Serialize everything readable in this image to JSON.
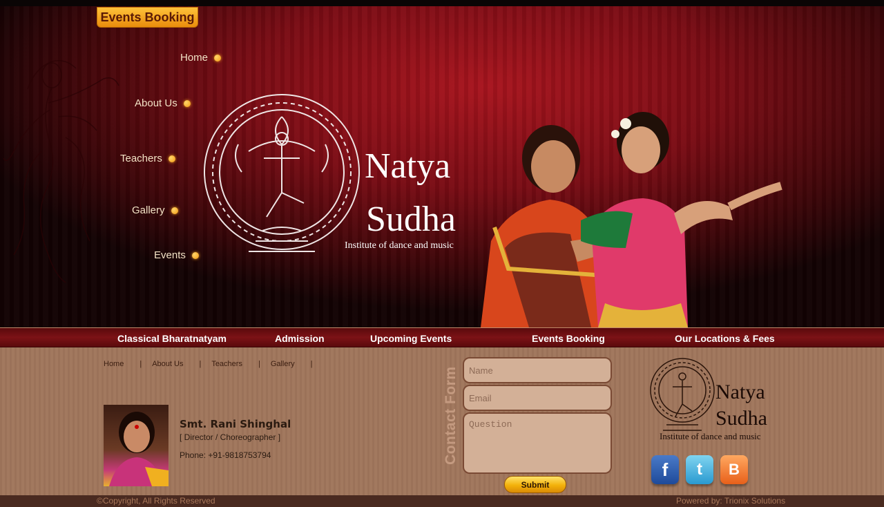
{
  "header": {
    "events_tab": "Events Booking",
    "nav": [
      "Home",
      "About Us",
      "Teachers",
      "Gallery",
      "Events"
    ],
    "brand_line1": "Natya",
    "brand_line2": "Sudha",
    "brand_tagline": "Institute of  dance and  music"
  },
  "menubar": [
    "Classical Bharatnatyam",
    "Admission",
    "Upcoming Events",
    "Events Booking",
    "Our Locations & Fees"
  ],
  "footer_links": [
    "Home",
    "About Us",
    "Teachers",
    "Gallery"
  ],
  "director": {
    "name": "Smt. Rani Shinghal",
    "role": "[ Director / Choreographer ]",
    "phone": "Phone: +91-9818753794"
  },
  "contact_form": {
    "title": "Contact Form",
    "name_placeholder": "Name",
    "email_placeholder": "Email",
    "question_placeholder": "Question",
    "submit_label": "Submit"
  },
  "side_brand": {
    "line1": "Natya",
    "line2": "Sudha",
    "tagline": "Institute of  dance and  music"
  },
  "social": {
    "facebook": "f",
    "twitter": "t",
    "blogger": "B",
    "icons": [
      "facebook-icon",
      "twitter-icon",
      "blogger-icon"
    ]
  },
  "footer": {
    "copyright": "©Copyright, All Rights Reserved",
    "powered": "Powered by: Trionix Solutions"
  },
  "colors": {
    "banner_red": "#7a0c14",
    "menu_bar": "#5a0a0c",
    "content_bg": "#a0765c",
    "accent_orange": "#f39a12"
  }
}
